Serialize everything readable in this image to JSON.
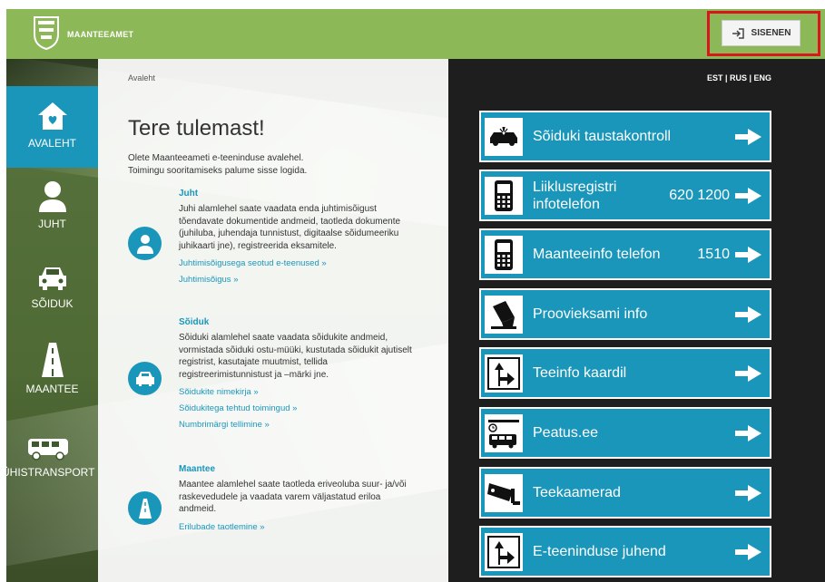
{
  "header": {
    "brand": "MAANTEEAMET",
    "login_label": "SISENEN"
  },
  "sidebar": {
    "items": [
      {
        "label": "AVALEHT",
        "icon": "house-icon",
        "active": true
      },
      {
        "label": "JUHT",
        "icon": "person-icon"
      },
      {
        "label": "SÕIDUK",
        "icon": "car-icon"
      },
      {
        "label": "MAANTEE",
        "icon": "road-icon"
      },
      {
        "label": "ÜHISTRANSPORT",
        "icon": "bus-icon"
      }
    ]
  },
  "main": {
    "breadcrumb": "Avaleht",
    "title": "Tere tulemast!",
    "intro_line1": "Olete Maanteeameti e-teeninduse avalehel.",
    "intro_line2": "Toimingu sooritamiseks palume sisse logida.",
    "sections": [
      {
        "heading": "Juht",
        "text": "Juhi alamlehel saate vaadata enda juhtimisõigust tõendavate dokumentide andmeid, taotleda dokumente (juhiluba, juhendaja tunnistust, digitaalse sõidumeeriku juhikaarti jne), registreerida eksamitele.",
        "links": [
          "Juhtimisõigusega seotud e-teenused »",
          "Juhtimisõigus »"
        ]
      },
      {
        "heading": "Sõiduk",
        "text": "Sõiduki alamlehel saate vaadata sõidukite andmeid, vormistada sõiduki ostu-müüki, kustutada sõidukit ajutiselt registrist, kasutajate muutmist, tellida registreerimistunnistust ja –märki jne.",
        "links": [
          "Sõidukite nimekirja »",
          "Sõidukitega tehtud toimingud »",
          "Numbrimärgi tellimine »"
        ]
      },
      {
        "heading": "Maantee",
        "text": "Maantee alamlehel saate taotleda eriveoluba suur- ja/või raskevedudele ja vaadata varem väljastatud eriloa andmeid.",
        "links": [
          "Erilubade taotlemine »"
        ]
      }
    ]
  },
  "right": {
    "languages": "EST | RUS | ENG",
    "tiles": [
      {
        "label": "Sõiduki taustakontroll",
        "number": "",
        "icon": "car-crash-icon"
      },
      {
        "label": "Liiklusregistri infotelefon",
        "number": "620 1200",
        "icon": "phone-icon"
      },
      {
        "label": "Maanteeinfo telefon",
        "number": "1510",
        "icon": "phone-icon"
      },
      {
        "label": "Proovieksami info",
        "number": "",
        "icon": "exam-icon"
      },
      {
        "label": "Teeinfo kaardil",
        "number": "",
        "icon": "road-sign-icon"
      },
      {
        "label": "Peatus.ee",
        "number": "",
        "icon": "bus-stop-icon"
      },
      {
        "label": "Teekaamerad",
        "number": "",
        "icon": "camera-icon"
      },
      {
        "label": "E-teeninduse juhend",
        "number": "",
        "icon": "road-sign-icon"
      }
    ]
  }
}
